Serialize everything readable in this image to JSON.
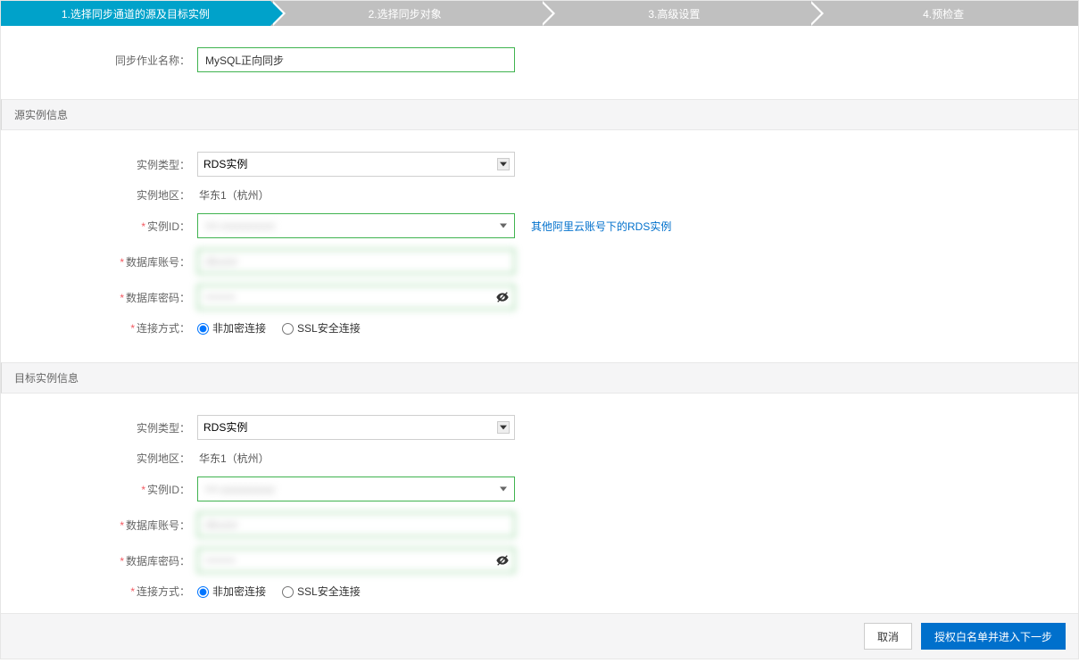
{
  "steps": {
    "s1": "1.选择同步通道的源及目标实例",
    "s2": "2.选择同步对象",
    "s3": "3.高级设置",
    "s4": "4.预检查"
  },
  "jobName": {
    "label": "同步作业名称：",
    "value": "MySQL正向同步"
  },
  "source": {
    "title": "源实例信息",
    "instanceTypeLabel": "实例类型：",
    "instanceTypeValue": "RDS实例",
    "regionLabel": "实例地区：",
    "regionValue": "华东1（杭州）",
    "instanceIdLabel": "实例ID：",
    "instanceIdValue": "rm-xxxxxxxxxx",
    "otherAccountLink": "其他阿里云账号下的RDS实例",
    "dbUserLabel": "数据库账号：",
    "dbUserValue": "dbuser",
    "dbPassLabel": "数据库密码：",
    "dbPassValue": "********",
    "connTypeLabel": "连接方式：",
    "connPlain": "非加密连接",
    "connSsl": "SSL安全连接"
  },
  "target": {
    "title": "目标实例信息",
    "instanceTypeLabel": "实例类型：",
    "instanceTypeValue": "RDS实例",
    "regionLabel": "实例地区：",
    "regionValue": "华东1（杭州）",
    "instanceIdLabel": "实例ID：",
    "instanceIdValue": "rm-yyyyyyyyyy",
    "dbUserLabel": "数据库账号：",
    "dbUserValue": "dbuser",
    "dbPassLabel": "数据库密码：",
    "dbPassValue": "********",
    "connTypeLabel": "连接方式：",
    "connPlain": "非加密连接",
    "connSsl": "SSL安全连接"
  },
  "footer": {
    "cancel": "取消",
    "next": "授权白名单并进入下一步"
  }
}
